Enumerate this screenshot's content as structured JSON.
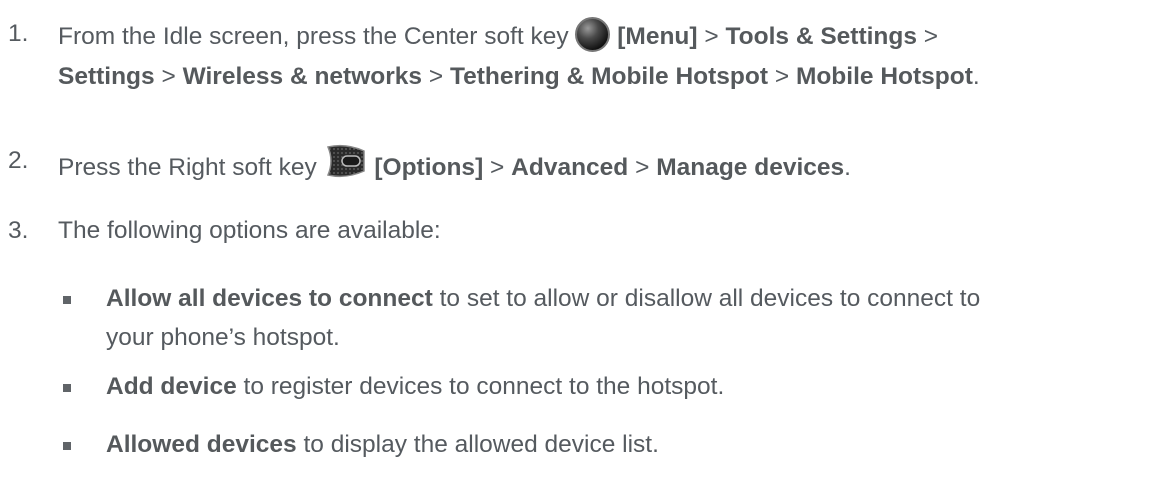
{
  "steps": [
    {
      "number": "1.",
      "line1": {
        "prefix": "From the Idle screen, press the Center soft key",
        "key_label": "[Menu]",
        "sep1": ">",
        "item1": "Tools & Settings",
        "sep2": ">"
      },
      "line2": {
        "item1": "Settings",
        "sep1": ">",
        "item2": "Wireless & networks",
        "sep2": ">",
        "item3": "Tethering & Mobile Hotspot",
        "sep3": ">",
        "item4": "Mobile Hotspot",
        "end": "."
      },
      "key_icon": "center-soft-key-icon"
    },
    {
      "number": "2.",
      "prefix": "Press the Right soft key",
      "key_label": "[Options]",
      "sep1": ">",
      "item1": "Advanced",
      "sep2": ">",
      "item2": "Manage devices",
      "end": ".",
      "key_icon": "right-soft-key-icon"
    },
    {
      "number": "3.",
      "text": "The following options are available:"
    }
  ],
  "options": [
    {
      "term": "Allow all devices to connect",
      "desc_line1": "to set to allow or disallow all devices to connect to",
      "desc_line2": "your phone’s hotspot."
    },
    {
      "term": "Add device",
      "desc": "to register devices to connect to the hotspot."
    },
    {
      "term": "Allowed devices",
      "desc": "to display the allowed device list."
    }
  ]
}
